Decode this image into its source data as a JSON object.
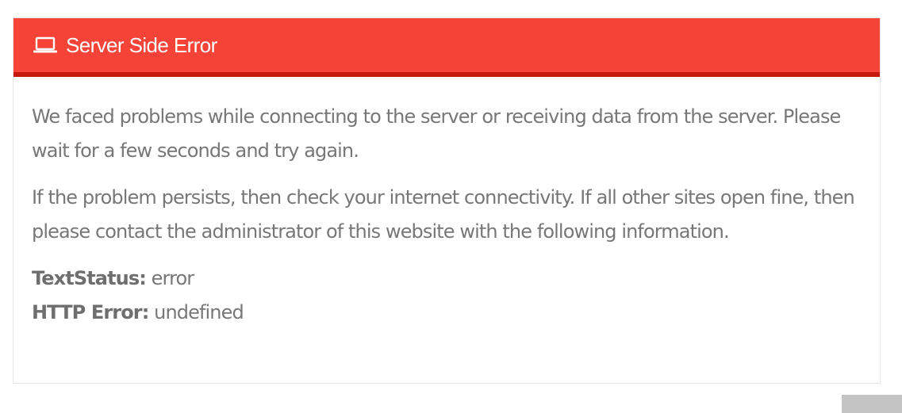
{
  "panel": {
    "title": "Server Side Error",
    "header_icon": "laptop-icon",
    "colors": {
      "header_bg": "#f54337",
      "header_border": "#c6170d",
      "text": "#777777"
    }
  },
  "body": {
    "paragraph_1": "We faced problems while connecting to the server or receiving data from the server. Please wait for a few seconds and try again.",
    "paragraph_2": "If the problem persists, then check your internet connectivity. If all other sites open fine, then please contact the administrator of this website with the following information."
  },
  "details": {
    "text_status_label": "TextStatus:",
    "text_status_value": "error",
    "http_error_label": "HTTP Error:",
    "http_error_value": "undefined"
  }
}
